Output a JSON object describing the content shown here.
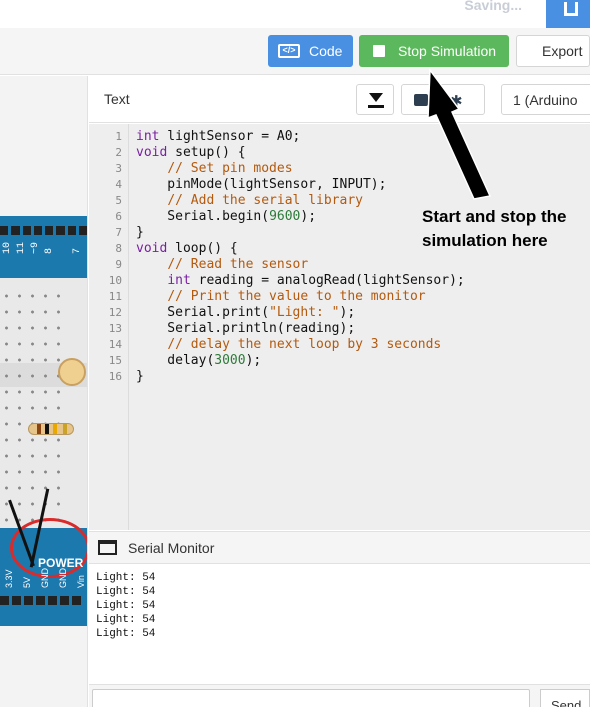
{
  "topbar": {
    "saving_text": "Saving..."
  },
  "toolbar": {
    "code_label": "Code",
    "code_icon": "</>",
    "stop_label": "Stop Simulation",
    "export_label": "Export"
  },
  "code_panel": {
    "mode_label": "Text",
    "device_select": "1 (Arduino",
    "lines": [
      "int lightSensor = A0;",
      "void setup() {",
      "    // Set pin modes",
      "    pinMode(lightSensor, INPUT);",
      "    // Add the serial library",
      "    Serial.begin(9600);",
      "}",
      "void loop() {",
      "    // Read the sensor",
      "    int reading = analogRead(lightSensor);",
      "    // Print the value to the monitor",
      "    Serial.print(\"Light: \");",
      "    Serial.println(reading);",
      "    // delay the next loop by 3 seconds",
      "    delay(3000);",
      "}"
    ],
    "line_numbers": [
      "1",
      "2",
      "3",
      "4",
      "5",
      "6",
      "7",
      "8",
      "9",
      "10",
      "11",
      "12",
      "13",
      "14",
      "15",
      "16"
    ]
  },
  "annotation": {
    "line1": "Start and stop the",
    "line2": "simulation here"
  },
  "serial_monitor": {
    "title": "Serial Monitor",
    "output": [
      "Light: 54",
      "Light: 54",
      "Light: 54",
      "Light: 54",
      "Light: 54"
    ],
    "send_label": "Send"
  },
  "board": {
    "pin_labels": [
      "10",
      "11",
      "~9",
      "8",
      "7"
    ],
    "power_label": "POWER",
    "power_pins": [
      "3.3V",
      "5V",
      "GND",
      "GND",
      "Vin"
    ]
  },
  "colors": {
    "code_button": "#4a90e2",
    "stop_button": "#5cb85c",
    "board_blue": "#1c79ad"
  }
}
